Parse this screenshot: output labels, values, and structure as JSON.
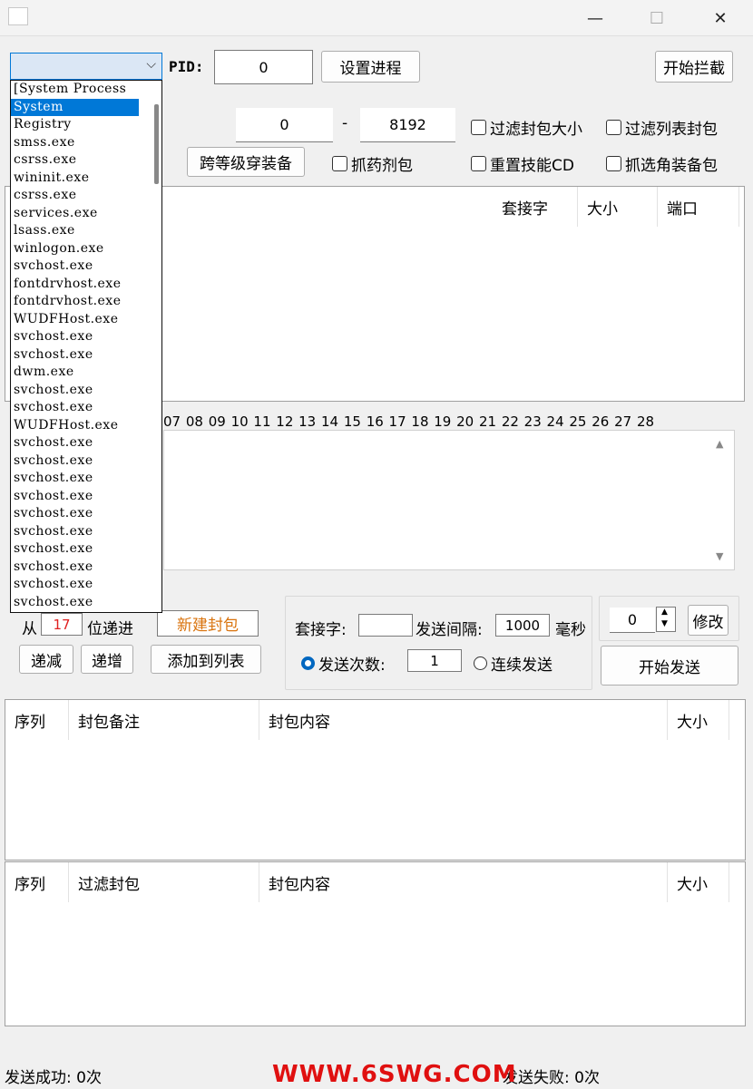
{
  "window": {
    "minimize_glyph": "—",
    "maximize_glyph": "☐",
    "close_glyph": "✕"
  },
  "top": {
    "pid_label": "PID:",
    "pid_value": "0",
    "set_process_button": "设置进程",
    "start_intercept_button": "开始拦截"
  },
  "filter": {
    "size_min": "0",
    "size_dash": "-",
    "size_max": "8192",
    "filter_size_label": "过滤封包大小",
    "filter_list_label": "过滤列表封包",
    "cross_level_button": "跨等级穿装备",
    "grab_potion_label": "抓药剂包",
    "reset_skill_label": "重置技能CD",
    "grab_select_label": "抓选角装备包"
  },
  "capture_table": {
    "columns": [
      "套接字",
      "大小",
      "端口"
    ]
  },
  "hex_ruler": "07 08 09 10 11 12 13 14 15 16 17 18 19 20 21 22 23 24 25 26 27 28",
  "packet_build": {
    "from_label": "从",
    "from_value": "17",
    "increment_label": "位递进",
    "new_packet_button": "新建封包",
    "decrement_button": "递减",
    "increment_button": "递增",
    "add_to_list_button": "添加到列表"
  },
  "send": {
    "socket_label": "套接字:",
    "socket_value": "",
    "interval_label": "发送间隔:",
    "interval_value": "1000",
    "ms_label": "毫秒",
    "count_label": "发送次数:",
    "count_value": "1",
    "continuous_label": "连续发送"
  },
  "side": {
    "spin_value": "0",
    "modify_button": "修改",
    "start_send_button": "开始发送"
  },
  "list1": {
    "columns": [
      "序列",
      "封包备注",
      "封包内容",
      "大小"
    ]
  },
  "list2": {
    "columns": [
      "序列",
      "过滤封包",
      "封包内容",
      "大小"
    ]
  },
  "status": {
    "success": "发送成功: 0次",
    "fail": "发送失败: 0次",
    "watermark": "WWW.6SWG.COM"
  },
  "process_dropdown": {
    "selected": "System",
    "items": [
      "[System Process",
      "System",
      "Registry",
      "smss.exe",
      "csrss.exe",
      "wininit.exe",
      "csrss.exe",
      "services.exe",
      "lsass.exe",
      "winlogon.exe",
      "svchost.exe",
      "fontdrvhost.exe",
      "fontdrvhost.exe",
      "WUDFHost.exe",
      "svchost.exe",
      "svchost.exe",
      "dwm.exe",
      "svchost.exe",
      "svchost.exe",
      "WUDFHost.exe",
      "svchost.exe",
      "svchost.exe",
      "svchost.exe",
      "svchost.exe",
      "svchost.exe",
      "svchost.exe",
      "svchost.exe",
      "svchost.exe",
      "svchost.exe",
      "svchost.exe"
    ]
  }
}
